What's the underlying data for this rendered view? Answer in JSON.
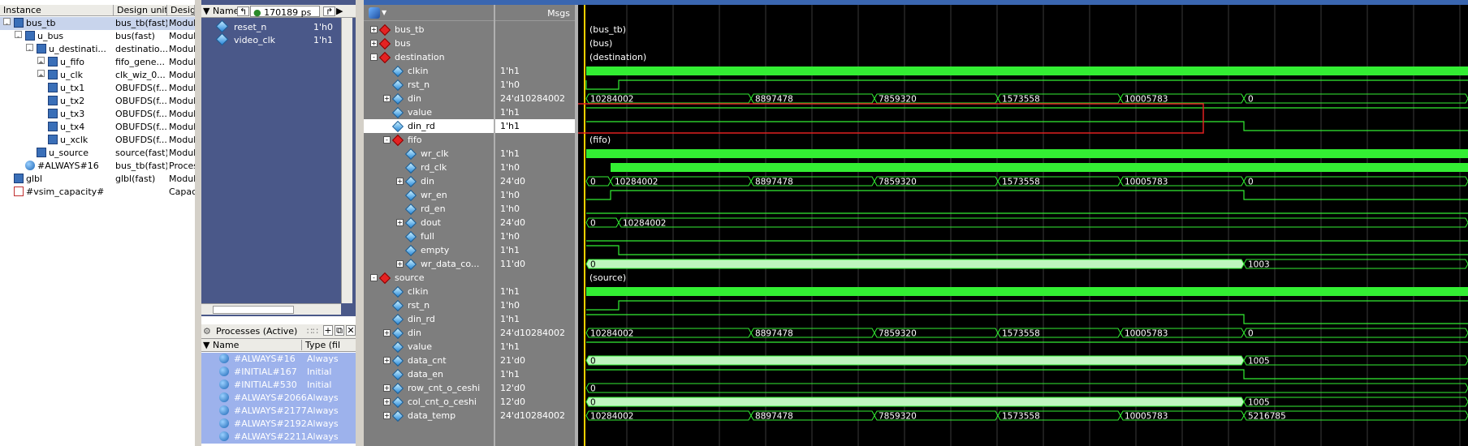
{
  "sim": {
    "columns": [
      "Instance",
      "Design unit",
      "Design"
    ],
    "rows": [
      {
        "name": "bus_tb",
        "unit": "bus_tb(fast)",
        "type": "Module",
        "depth": 0,
        "exp": "-",
        "icon": "mod",
        "sel": true
      },
      {
        "name": "u_bus",
        "unit": "bus(fast)",
        "type": "Module",
        "depth": 1,
        "exp": "-",
        "icon": "mod"
      },
      {
        "name": "u_destinati...",
        "unit": "destinatio...",
        "type": "Module",
        "depth": 2,
        "exp": "-",
        "icon": "mod"
      },
      {
        "name": "u_fifo",
        "unit": "fifo_gene...",
        "type": "Module",
        "depth": 3,
        "exp": "+",
        "icon": "mod"
      },
      {
        "name": "u_clk",
        "unit": "clk_wiz_0...",
        "type": "Module",
        "depth": 3,
        "exp": "+",
        "icon": "mod"
      },
      {
        "name": "u_tx1",
        "unit": "OBUFDS(f...",
        "type": "Module",
        "depth": 3,
        "exp": "",
        "icon": "mod"
      },
      {
        "name": "u_tx2",
        "unit": "OBUFDS(f...",
        "type": "Module",
        "depth": 3,
        "exp": "",
        "icon": "mod"
      },
      {
        "name": "u_tx3",
        "unit": "OBUFDS(f...",
        "type": "Module",
        "depth": 3,
        "exp": "",
        "icon": "mod"
      },
      {
        "name": "u_tx4",
        "unit": "OBUFDS(f...",
        "type": "Module",
        "depth": 3,
        "exp": "",
        "icon": "mod"
      },
      {
        "name": "u_xclk",
        "unit": "OBUFDS(f...",
        "type": "Module",
        "depth": 3,
        "exp": "",
        "icon": "mod"
      },
      {
        "name": "u_source",
        "unit": "source(fast)",
        "type": "Module",
        "depth": 2,
        "exp": "",
        "icon": "mod"
      },
      {
        "name": "#ALWAYS#16",
        "unit": "bus_tb(fast)",
        "type": "Process",
        "depth": 1,
        "exp": "",
        "icon": "proc"
      },
      {
        "name": "glbl",
        "unit": "glbl(fast)",
        "type": "Module",
        "depth": 0,
        "exp": "",
        "icon": "mod"
      },
      {
        "name": "#vsim_capacity#",
        "unit": "",
        "type": "Capaci",
        "depth": 0,
        "exp": "",
        "icon": "cap"
      }
    ]
  },
  "objects": {
    "name_col": "Name",
    "time": "170189 ps",
    "rows": [
      {
        "name": "reset_n",
        "value": "1'h0"
      },
      {
        "name": "video_clk",
        "value": "1'h1"
      }
    ]
  },
  "processes": {
    "title": "Processes (Active)",
    "columns": [
      "Name",
      "Type (fil"
    ],
    "rows": [
      {
        "name": "#ALWAYS#16",
        "type": "Always"
      },
      {
        "name": "#INITIAL#167",
        "type": "Initial"
      },
      {
        "name": "#INITIAL#530",
        "type": "Initial"
      },
      {
        "name": "#ALWAYS#2066",
        "type": "Always"
      },
      {
        "name": "#ALWAYS#2177",
        "type": "Always"
      },
      {
        "name": "#ALWAYS#2192",
        "type": "Always"
      },
      {
        "name": "#ALWAYS#2211",
        "type": "Always"
      }
    ]
  },
  "wave": {
    "msgs_label": "Msgs",
    "signals": [
      {
        "name": "bus_tb",
        "value": "",
        "depth": 0,
        "kind": "grp",
        "exp": "+",
        "wave": {
          "t": "label",
          "text": "bus_tb"
        }
      },
      {
        "name": "bus",
        "value": "",
        "depth": 0,
        "kind": "grp",
        "exp": "+",
        "wave": {
          "t": "label",
          "text": "bus"
        }
      },
      {
        "name": "destination",
        "value": "",
        "depth": 0,
        "kind": "grp",
        "exp": "-",
        "wave": {
          "t": "label",
          "text": "destination"
        }
      },
      {
        "name": "clkin",
        "value": "1'h1",
        "depth": 1,
        "kind": "sig",
        "exp": "",
        "wave": {
          "t": "clk",
          "start": 0
        }
      },
      {
        "name": "rst_n",
        "value": "1'h0",
        "depth": 1,
        "kind": "sig",
        "exp": "",
        "wave": {
          "t": "bit",
          "init": 1,
          "edges": [
            {
              "at": 0.0,
              "v": 0
            },
            {
              "at": 0.04,
              "v": 1
            }
          ]
        }
      },
      {
        "name": "din",
        "value": "24'd10284002",
        "depth": 1,
        "kind": "sig",
        "exp": "+",
        "wave": {
          "t": "bus",
          "segs": [
            {
              "from": 0.0,
              "text": "10284002"
            },
            {
              "from": 0.203,
              "text": "8897478"
            },
            {
              "from": 0.355,
              "text": "7859320"
            },
            {
              "from": 0.507,
              "text": "1573558"
            },
            {
              "from": 0.658,
              "text": "10005783"
            },
            {
              "from": 0.81,
              "text": "0"
            }
          ]
        }
      },
      {
        "name": "value",
        "value": "1'h1",
        "depth": 1,
        "kind": "sig",
        "exp": "",
        "wave": {
          "t": "bit",
          "init": 1,
          "edges": []
        }
      },
      {
        "name": "din_rd",
        "value": "1'h1",
        "depth": 1,
        "kind": "sig",
        "exp": "",
        "hl": true,
        "wave": {
          "t": "bit",
          "init": 1,
          "edges": [
            {
              "at": 0.81,
              "v": 0
            }
          ]
        }
      },
      {
        "name": "fifo",
        "value": "",
        "depth": 1,
        "kind": "grp",
        "exp": "-",
        "wave": {
          "t": "label",
          "text": "fifo"
        }
      },
      {
        "name": "wr_clk",
        "value": "1'h1",
        "depth": 2,
        "kind": "sig",
        "exp": "",
        "wave": {
          "t": "clk",
          "start": 0
        }
      },
      {
        "name": "rd_clk",
        "value": "1'h0",
        "depth": 2,
        "kind": "sig",
        "exp": "",
        "wave": {
          "t": "clk",
          "start": 0.03
        }
      },
      {
        "name": "din",
        "value": "24'd0",
        "depth": 2,
        "kind": "sig",
        "exp": "+",
        "wave": {
          "t": "bus",
          "segs": [
            {
              "from": 0.0,
              "text": "0"
            },
            {
              "from": 0.03,
              "text": "10284002"
            },
            {
              "from": 0.203,
              "text": "8897478"
            },
            {
              "from": 0.355,
              "text": "7859320"
            },
            {
              "from": 0.507,
              "text": "1573558"
            },
            {
              "from": 0.658,
              "text": "10005783"
            },
            {
              "from": 0.81,
              "text": "0"
            }
          ]
        }
      },
      {
        "name": "wr_en",
        "value": "1'h0",
        "depth": 2,
        "kind": "sig",
        "exp": "",
        "wave": {
          "t": "bit",
          "init": 0,
          "edges": [
            {
              "at": 0.03,
              "v": 1
            },
            {
              "at": 0.81,
              "v": 0
            }
          ]
        }
      },
      {
        "name": "rd_en",
        "value": "1'h0",
        "depth": 2,
        "kind": "sig",
        "exp": "",
        "wave": {
          "t": "bit",
          "init": 0,
          "edges": [
            {
              "at": 0.81,
              "v": 0
            }
          ]
        }
      },
      {
        "name": "dout",
        "value": "24'd0",
        "depth": 2,
        "kind": "sig",
        "exp": "+",
        "wave": {
          "t": "bus",
          "segs": [
            {
              "from": 0.0,
              "text": "0"
            },
            {
              "from": 0.04,
              "text": "10284002"
            }
          ]
        }
      },
      {
        "name": "full",
        "value": "1'h0",
        "depth": 2,
        "kind": "sig",
        "exp": "",
        "wave": {
          "t": "bit",
          "init": 0,
          "edges": []
        }
      },
      {
        "name": "empty",
        "value": "1'h1",
        "depth": 2,
        "kind": "sig",
        "exp": "",
        "wave": {
          "t": "bit",
          "init": 1,
          "edges": [
            {
              "at": 0.04,
              "v": 0
            }
          ]
        }
      },
      {
        "name": "wr_data_co...",
        "value": "11'd0",
        "depth": 2,
        "kind": "sig",
        "exp": "+",
        "wave": {
          "t": "bus",
          "dense": true,
          "segs": [
            {
              "from": 0.0,
              "text": "0"
            },
            {
              "from": 0.81,
              "text": "1003"
            }
          ]
        }
      },
      {
        "name": "source",
        "value": "",
        "depth": 0,
        "kind": "grp",
        "exp": "-",
        "wave": {
          "t": "label",
          "text": "source"
        }
      },
      {
        "name": "clkin",
        "value": "1'h1",
        "depth": 1,
        "kind": "sig",
        "exp": "",
        "wave": {
          "t": "clk",
          "start": 0
        }
      },
      {
        "name": "rst_n",
        "value": "1'h0",
        "depth": 1,
        "kind": "sig",
        "exp": "",
        "wave": {
          "t": "bit",
          "init": 0,
          "edges": [
            {
              "at": 0.04,
              "v": 1
            }
          ]
        }
      },
      {
        "name": "din_rd",
        "value": "1'h1",
        "depth": 1,
        "kind": "sig",
        "exp": "",
        "wave": {
          "t": "bit",
          "init": 1,
          "edges": [
            {
              "at": 0.81,
              "v": 0
            }
          ]
        }
      },
      {
        "name": "din",
        "value": "24'd10284002",
        "depth": 1,
        "kind": "sig",
        "exp": "+",
        "wave": {
          "t": "bus",
          "segs": [
            {
              "from": 0.0,
              "text": "10284002"
            },
            {
              "from": 0.203,
              "text": "8897478"
            },
            {
              "from": 0.355,
              "text": "7859320"
            },
            {
              "from": 0.507,
              "text": "1573558"
            },
            {
              "from": 0.658,
              "text": "10005783"
            },
            {
              "from": 0.81,
              "text": "0"
            }
          ]
        }
      },
      {
        "name": "value",
        "value": "1'h1",
        "depth": 1,
        "kind": "sig",
        "exp": "",
        "wave": {
          "t": "bit",
          "init": 1,
          "edges": []
        }
      },
      {
        "name": "data_cnt",
        "value": "21'd0",
        "depth": 1,
        "kind": "sig",
        "exp": "+",
        "wave": {
          "t": "bus",
          "dense": true,
          "segs": [
            {
              "from": 0.0,
              "text": "0"
            },
            {
              "from": 0.81,
              "text": "1005"
            }
          ]
        }
      },
      {
        "name": "data_en",
        "value": "1'h1",
        "depth": 1,
        "kind": "sig",
        "exp": "",
        "wave": {
          "t": "bit",
          "init": 1,
          "edges": [
            {
              "at": 0.81,
              "v": 0
            }
          ]
        }
      },
      {
        "name": "row_cnt_o_ceshi",
        "value": "12'd0",
        "depth": 1,
        "kind": "sig",
        "exp": "+",
        "wave": {
          "t": "bus",
          "segs": [
            {
              "from": 0.0,
              "text": "0"
            }
          ]
        }
      },
      {
        "name": "col_cnt_o_ceshi",
        "value": "12'd0",
        "depth": 1,
        "kind": "sig",
        "exp": "+",
        "wave": {
          "t": "bus",
          "dense": true,
          "segs": [
            {
              "from": 0.0,
              "text": "0"
            },
            {
              "from": 0.81,
              "text": "1005"
            }
          ]
        }
      },
      {
        "name": "data_temp",
        "value": "24'd10284002",
        "depth": 1,
        "kind": "sig",
        "exp": "+",
        "wave": {
          "t": "bus",
          "segs": [
            {
              "from": 0.0,
              "text": "10284002"
            },
            {
              "from": 0.203,
              "text": "8897478"
            },
            {
              "from": 0.355,
              "text": "7859320"
            },
            {
              "from": 0.507,
              "text": "1573558"
            },
            {
              "from": 0.658,
              "text": "10005783"
            },
            {
              "from": 0.81,
              "text": "5216785"
            }
          ]
        }
      }
    ]
  }
}
